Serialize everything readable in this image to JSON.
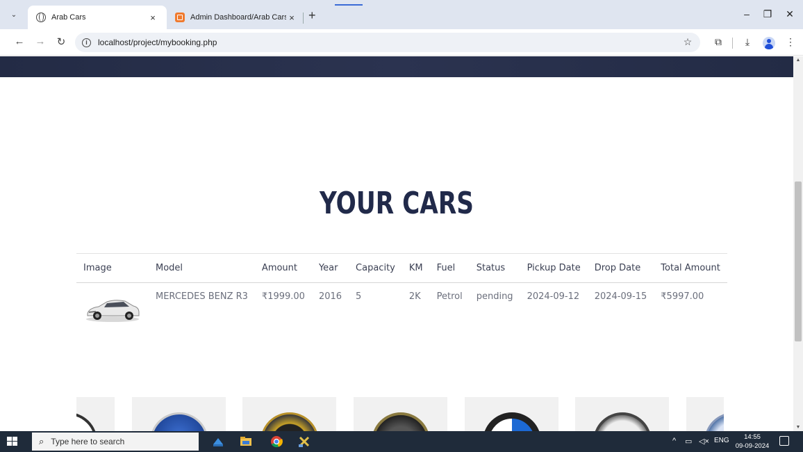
{
  "browser": {
    "tabs": [
      {
        "title": "Arab Cars",
        "active": true
      },
      {
        "title": "Admin Dashboard/Arab Cars",
        "active": false
      }
    ],
    "close_glyph": "×",
    "new_tab_glyph": "+",
    "url": "localhost/project/mybooking.php",
    "window_controls": {
      "minimize": "–",
      "restore": "❐",
      "close": "✕"
    }
  },
  "page": {
    "heading": "YOUR CARS",
    "table": {
      "columns": [
        "Image",
        "Model",
        "Amount",
        "Year",
        "Capacity",
        "KM",
        "Fuel",
        "Status",
        "Pickup Date",
        "Drop Date",
        "Total Amount"
      ],
      "rows": [
        {
          "image": "car-image",
          "model": "MERCEDES BENZ R3",
          "amount": "₹1999.00",
          "year": "2016",
          "capacity": "5",
          "km": "2K",
          "fuel": "Petrol",
          "status": "pending",
          "pickup_date": "2024-09-12",
          "drop_date": "2024-09-15",
          "total_amount": "₹5997.00"
        }
      ]
    },
    "brand_logos": [
      "brand-logo",
      "saab-logo",
      "mercedes-logo",
      "brand-logo",
      "bmw-logo",
      "brand-logo",
      "brand-logo"
    ],
    "scroll_top_glyph": "^",
    "colors": {
      "heading": "#212a4a",
      "navbar": "#232b45",
      "accent": "#f47b20"
    }
  },
  "taskbar": {
    "search_placeholder": "Type here to search",
    "language": "ENG",
    "time": "14:55",
    "date": "09-09-2024"
  }
}
